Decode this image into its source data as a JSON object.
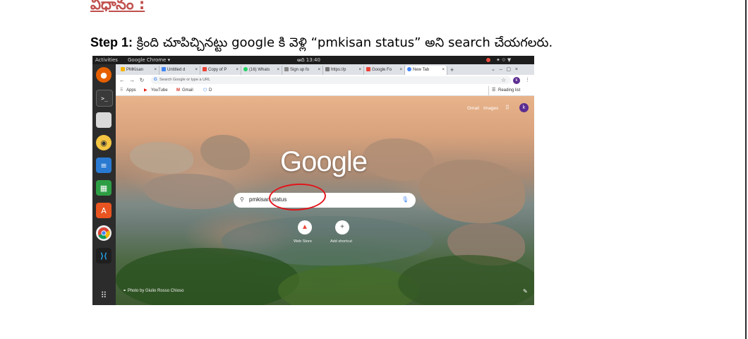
{
  "document": {
    "heading": "విధానం :",
    "step_label": "Step 1:",
    "step_text": " క్రింది చూపిచ్చినట్టు google కి వెళ్లి “pmkisan status” అని search చేయగలరు."
  },
  "screenshot": {
    "topbar": {
      "activities": "Activities",
      "app_name": "Google Chrome ▾",
      "clock": "ఆది 13:40"
    },
    "tabs": [
      {
        "label": "PMKisan",
        "color": "#f4b400"
      },
      {
        "label": "Untitled d",
        "color": "#4285f4"
      },
      {
        "label": "Copy of P",
        "color": "#ea4335"
      },
      {
        "label": "(16) Whats",
        "color": "#25d366"
      },
      {
        "label": "Sign up fo",
        "color": "#888888"
      },
      {
        "label": "https://p",
        "color": "#777777"
      },
      {
        "label": "Google Fo",
        "color": "#ea4335"
      },
      {
        "label": "New Tab",
        "color": "#4285f4"
      }
    ],
    "omnibox_placeholder": "Search Google or type a URL",
    "profile_initial": "k",
    "bookmarks": {
      "apps": "Apps",
      "youtube": "YouTube",
      "gmail": "Gmail",
      "d": "D",
      "reading_list": "Reading list"
    },
    "ntp": {
      "gmail_link": "Gmail",
      "images_link": "Images",
      "avatar_initial": "k",
      "logo": "Google",
      "search_value": "pmkisan status",
      "shortcuts": [
        {
          "icon": "▲",
          "label": "Web Store"
        },
        {
          "icon": "+",
          "label": "Add shortcut"
        }
      ],
      "photo_credit": "Photo by Giulio Rosso Chioso"
    }
  }
}
